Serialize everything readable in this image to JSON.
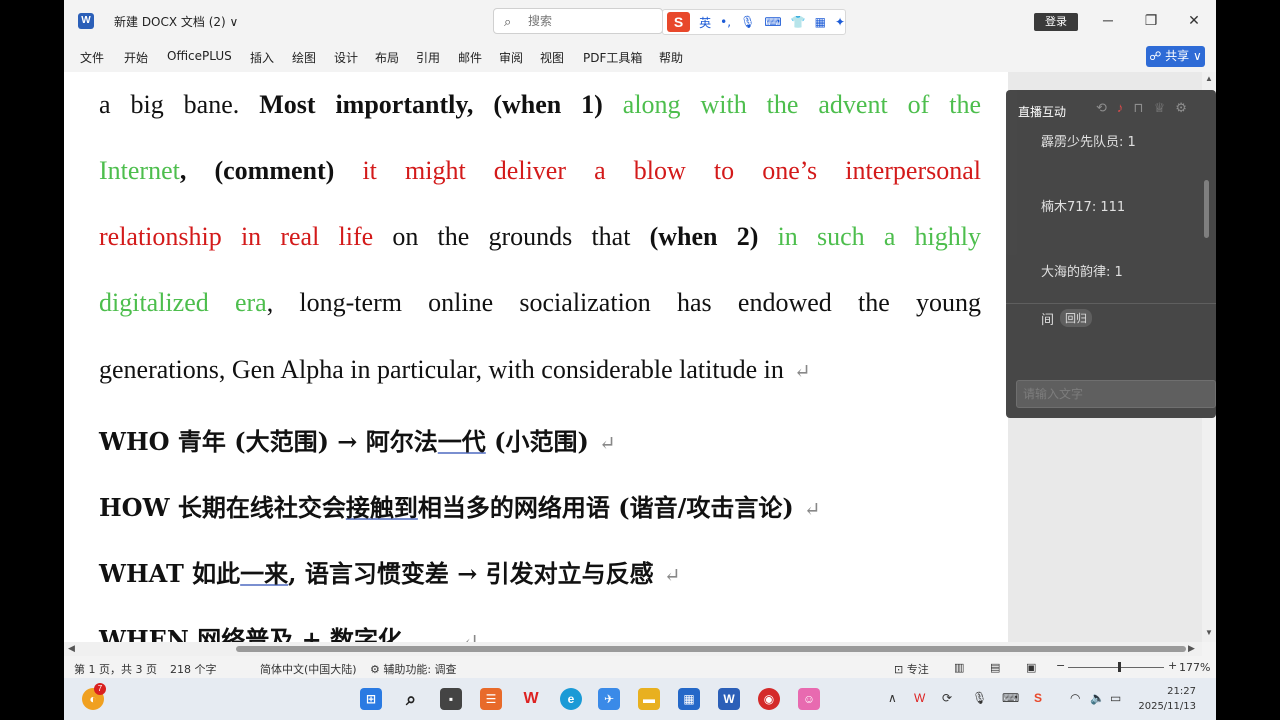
{
  "titlebar": {
    "doc_title": "新建 DOCX 文档 (2) ∨",
    "search_placeholder": "搜索",
    "ime_logo": "S",
    "ime_lang": "英",
    "login": "登录",
    "minimize": "─",
    "restore": "❐",
    "close": "✕"
  },
  "menu": [
    "文件",
    "开始",
    "OfficePLUS",
    "插入",
    "绘图",
    "设计",
    "布局",
    "引用",
    "邮件",
    "审阅",
    "视图",
    "PDF工具箱",
    "帮助"
  ],
  "share_label": "☍ 共享 ∨",
  "document": {
    "l1": {
      "a": "a big bane. ",
      "b": "Most importantly, (when 1)",
      "c": " along with the advent of the"
    },
    "l2": {
      "a": "Internet",
      "b": ", (comment)",
      "c": " it might deliver a blow to one’s interpersonal"
    },
    "l3": {
      "a": "relationship in real life",
      "b": " on the grounds that ",
      "c": "(when 2)",
      "d": " in such a highly"
    },
    "l4": {
      "a": "digitalized era",
      "b": ", long-term online socialization has endowed the young"
    },
    "l5": {
      "a": "generations, Gen Alpha in particular, with considerable latitude in"
    },
    "l6": {
      "a": "WHO  青年 (大范围) → 阿尔法",
      "u": "一代",
      "b": " (小范围)"
    },
    "l7": {
      "a": "HOW  长期在线社交会",
      "u": "接触到",
      "b": "相当多的网络用语 (谐音/攻击言论)"
    },
    "l8": {
      "a": "WHAT  如此",
      "u": "一来",
      "b": ", 语言习惯变差 → 引发对立与反感"
    },
    "l9": {
      "a": "WHEN  网络普及 + 数字化"
    },
    "para_mark": "↵"
  },
  "live": {
    "title": "直播互动",
    "comments": [
      "霹雳少先队员: 1",
      "楠木717: 111",
      "大海的韵律: 1"
    ],
    "prefix": "间",
    "back_label": "回归",
    "input_placeholder": "请输入文字"
  },
  "status": {
    "page": "第 1 页，共 3 页",
    "words": "218 个字",
    "lang": "简体中文(中国大陆)",
    "accessibility": "⚙ 辅助功能: 调查",
    "focus": "专注",
    "zoom_out": "−",
    "zoom_in": "+",
    "zoom": "177%"
  },
  "taskbar": {
    "badge": "7",
    "time": "21:27",
    "date": "2025/11/13"
  }
}
